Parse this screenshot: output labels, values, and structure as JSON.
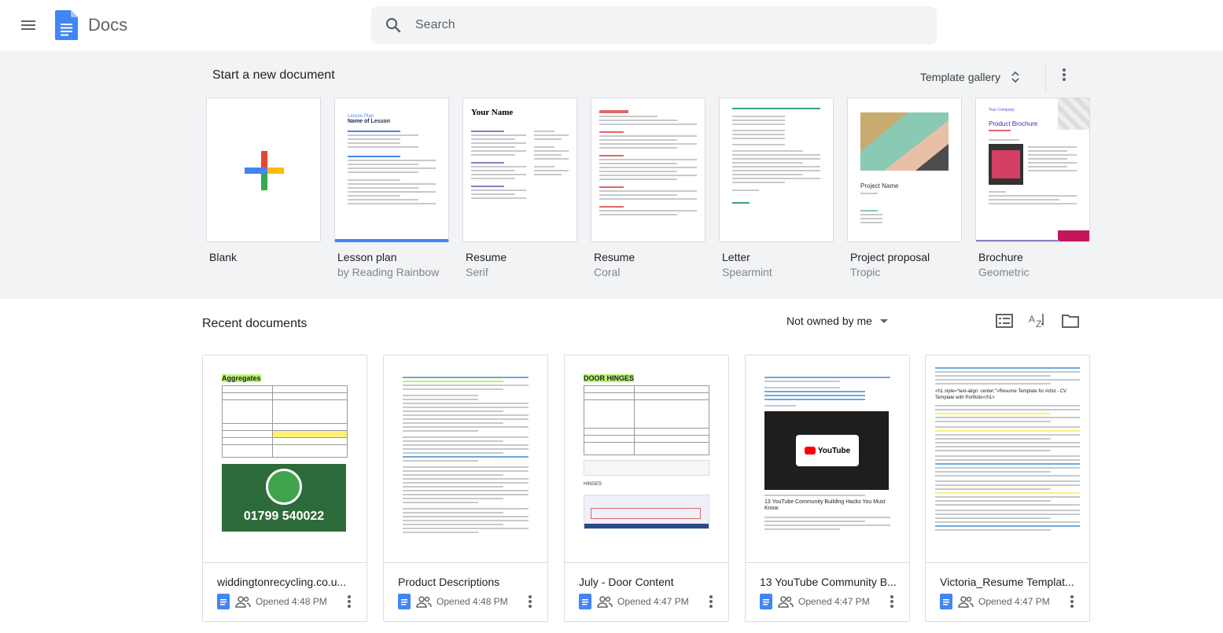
{
  "app": {
    "name": "Docs"
  },
  "search": {
    "placeholder": "Search"
  },
  "templates": {
    "heading": "Start a new document",
    "gallery_label": "Template gallery",
    "items": [
      {
        "name": "Blank",
        "sub": ""
      },
      {
        "name": "Lesson plan",
        "sub": "by Reading Rainbow"
      },
      {
        "name": "Resume",
        "sub": "Serif"
      },
      {
        "name": "Resume",
        "sub": "Coral"
      },
      {
        "name": "Letter",
        "sub": "Spearmint"
      },
      {
        "name": "Project proposal",
        "sub": "Tropic"
      },
      {
        "name": "Brochure",
        "sub": "Geometric"
      }
    ],
    "thumb_text": {
      "lesson_title": "Lesson Plan",
      "lesson_sub": "Name of Lesson",
      "resume_name": "Your Name",
      "project_name": "Project Name",
      "brochure_company": "Your Company",
      "brochure_title": "Product Brochure"
    }
  },
  "recent": {
    "heading": "Recent documents",
    "owner_filter": "Not owned by me",
    "docs": [
      {
        "title": "widdingtonrecycling.co.u...",
        "opened": "Opened 4:48 PM",
        "thumb_heading": "Aggregates",
        "thumb_phone": "01799 540022"
      },
      {
        "title": "Product Descriptions",
        "opened": "Opened 4:48 PM"
      },
      {
        "title": "July - Door Content",
        "opened": "Opened 4:47 PM",
        "thumb_heading": "DOOR HINGES",
        "thumb_sub": "HINGES"
      },
      {
        "title": "13 YouTube Community B...",
        "opened": "Opened 4:47 PM",
        "thumb_heading": "13 YouTube Community Building Hacks You Must Know",
        "thumb_logo": "YouTube"
      },
      {
        "title": "Victoria_Resume Templat...",
        "opened": "Opened 4:47 PM",
        "thumb_heading": "<h1 style=\"text-align: center;\">Resume Template for Artist - CV Template with Portfolio</h1>"
      }
    ]
  },
  "colors": {
    "docs_blue": "#4285f4",
    "highlight": "#b7f56d",
    "page_gray": "#f1f3f4"
  }
}
